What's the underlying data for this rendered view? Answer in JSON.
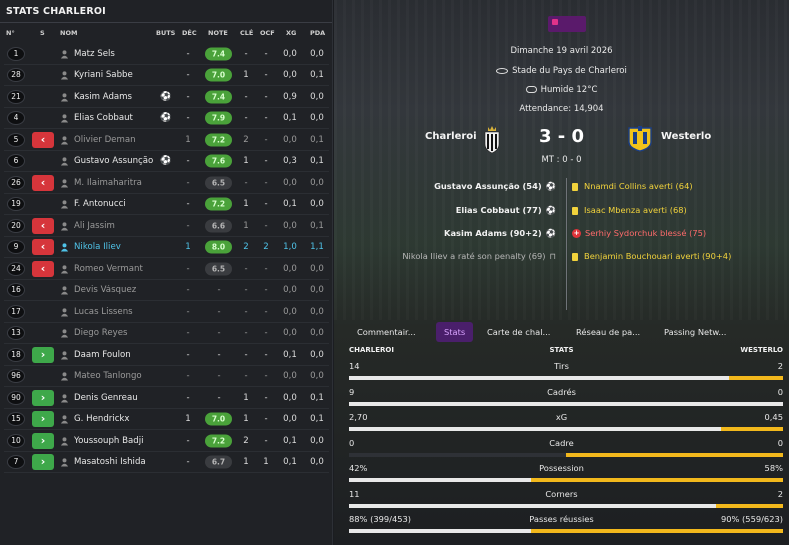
{
  "left_panel": {
    "title": "STATS CHARLEROI",
    "columns": {
      "num": "N°",
      "s": "S",
      "name": "NOM",
      "buts": "BUTS",
      "dec": "DÉC",
      "note": "NOTE",
      "cle": "CLÉ",
      "ocf": "OCF",
      "xg": "XG",
      "pda": "PDA"
    },
    "players": [
      {
        "num": "1",
        "sub": "",
        "name": "Matz Sels",
        "ball": "",
        "dec": "-",
        "rating": "7.4",
        "rating_style": "good",
        "cle": "-",
        "ocf": "-",
        "xg": "0,0",
        "pda": "0,0",
        "style": "normal",
        "buts": ""
      },
      {
        "num": "28",
        "sub": "",
        "name": "Kyriani Sabbe",
        "ball": "",
        "dec": "-",
        "rating": "7.0",
        "rating_style": "good",
        "cle": "1",
        "ocf": "-",
        "xg": "0,0",
        "pda": "0,1",
        "style": "normal",
        "buts": ""
      },
      {
        "num": "21",
        "sub": "",
        "name": "Kasim Adams",
        "ball": "⚽",
        "dec": "-",
        "rating": "7.4",
        "rating_style": "good",
        "cle": "-",
        "ocf": "-",
        "xg": "0,9",
        "pda": "0,0",
        "style": "normal",
        "buts": ""
      },
      {
        "num": "4",
        "sub": "",
        "name": "Elias Cobbaut",
        "ball": "⚽",
        "dec": "-",
        "rating": "7.9",
        "rating_style": "good",
        "cle": "-",
        "ocf": "-",
        "xg": "0,1",
        "pda": "0,0",
        "style": "normal",
        "buts": ""
      },
      {
        "num": "5",
        "sub": "out",
        "name": "Olivier Deman",
        "ball": "",
        "dec": "1",
        "rating": "7.2",
        "rating_style": "good",
        "cle": "2",
        "ocf": "-",
        "xg": "0,0",
        "pda": "0,1",
        "style": "dim",
        "buts": ""
      },
      {
        "num": "6",
        "sub": "",
        "name": "Gustavo Assunção",
        "ball": "⚽",
        "dec": "-",
        "rating": "7.6",
        "rating_style": "good",
        "cle": "1",
        "ocf": "-",
        "xg": "0,3",
        "pda": "0,1",
        "style": "normal",
        "buts": ""
      },
      {
        "num": "26",
        "sub": "out",
        "name": "M. Ilaimaharitra",
        "ball": "",
        "dec": "-",
        "rating": "6.5",
        "rating_style": "neutral",
        "cle": "-",
        "ocf": "-",
        "xg": "0,0",
        "pda": "0,0",
        "style": "dim",
        "buts": ""
      },
      {
        "num": "19",
        "sub": "",
        "name": "F. Antonucci",
        "ball": "",
        "dec": "-",
        "rating": "7.2",
        "rating_style": "good",
        "cle": "1",
        "ocf": "-",
        "xg": "0,1",
        "pda": "0,0",
        "style": "normal",
        "buts": ""
      },
      {
        "num": "20",
        "sub": "out",
        "name": "Ali Jassim",
        "ball": "",
        "dec": "-",
        "rating": "6.6",
        "rating_style": "neutral",
        "cle": "1",
        "ocf": "-",
        "xg": "0,0",
        "pda": "0,1",
        "style": "dim",
        "buts": ""
      },
      {
        "num": "9",
        "sub": "out",
        "name": "Nikola Iliev",
        "ball": "",
        "dec": "1",
        "rating": "8.0",
        "rating_style": "good",
        "cle": "2",
        "ocf": "2",
        "xg": "1,0",
        "pda": "1,1",
        "style": "hl",
        "buts": ""
      },
      {
        "num": "24",
        "sub": "out",
        "name": "Romeo Vermant",
        "ball": "",
        "dec": "-",
        "rating": "6.5",
        "rating_style": "neutral",
        "cle": "-",
        "ocf": "-",
        "xg": "0,0",
        "pda": "0,0",
        "style": "dim",
        "buts": ""
      },
      {
        "num": "16",
        "sub": "",
        "name": "Devis Vásquez",
        "ball": "",
        "dec": "-",
        "rating": "-",
        "rating_style": "none",
        "cle": "-",
        "ocf": "-",
        "xg": "0,0",
        "pda": "0,0",
        "style": "dim",
        "buts": ""
      },
      {
        "num": "17",
        "sub": "",
        "name": "Lucas Lissens",
        "ball": "",
        "dec": "-",
        "rating": "-",
        "rating_style": "none",
        "cle": "-",
        "ocf": "-",
        "xg": "0,0",
        "pda": "0,0",
        "style": "dim",
        "buts": ""
      },
      {
        "num": "13",
        "sub": "",
        "name": "Diego Reyes",
        "ball": "",
        "dec": "-",
        "rating": "-",
        "rating_style": "none",
        "cle": "-",
        "ocf": "-",
        "xg": "0,0",
        "pda": "0,0",
        "style": "dim",
        "buts": ""
      },
      {
        "num": "18",
        "sub": "in",
        "name": "Daam Foulon",
        "ball": "",
        "dec": "-",
        "rating": "-",
        "rating_style": "none",
        "cle": "-",
        "ocf": "-",
        "xg": "0,1",
        "pda": "0,0",
        "style": "normal",
        "buts": ""
      },
      {
        "num": "96",
        "sub": "",
        "name": "Mateo Tanlongo",
        "ball": "",
        "dec": "-",
        "rating": "-",
        "rating_style": "none",
        "cle": "-",
        "ocf": "-",
        "xg": "0,0",
        "pda": "0,0",
        "style": "dim",
        "buts": ""
      },
      {
        "num": "90",
        "sub": "in",
        "name": "Denis Genreau",
        "ball": "",
        "dec": "-",
        "rating": "-",
        "rating_style": "none",
        "cle": "1",
        "ocf": "-",
        "xg": "0,0",
        "pda": "0,1",
        "style": "normal",
        "buts": ""
      },
      {
        "num": "15",
        "sub": "in",
        "name": "G. Hendrickx",
        "ball": "",
        "dec": "1",
        "rating": "7.0",
        "rating_style": "good",
        "cle": "1",
        "ocf": "-",
        "xg": "0,0",
        "pda": "0,1",
        "style": "normal",
        "buts": ""
      },
      {
        "num": "10",
        "sub": "in",
        "name": "Youssouph Badji",
        "ball": "",
        "dec": "-",
        "rating": "7.2",
        "rating_style": "good",
        "cle": "2",
        "ocf": "-",
        "xg": "0,1",
        "pda": "0,0",
        "style": "normal",
        "buts": ""
      },
      {
        "num": "7",
        "sub": "in",
        "name": "Masatoshi Ishida",
        "ball": "",
        "dec": "-",
        "rating": "6.7",
        "rating_style": "neutral",
        "cle": "1",
        "ocf": "1",
        "xg": "0,1",
        "pda": "0,0",
        "style": "normal",
        "buts": ""
      }
    ]
  },
  "match": {
    "date": "Dimanche 19 avril 2026",
    "stadium": "Stade du Pays de Charleroi",
    "weather": "Humide 12°C",
    "attendance": "Attendance: 14,904",
    "home_team": "Charleroi",
    "away_team": "Westerlo",
    "score": "3 - 0",
    "half_time": "MT : 0 - 0",
    "home_events": [
      {
        "text": "Gustavo Assunção (54)",
        "icon": "⚽",
        "muted": false
      },
      {
        "text": "Elias Cobbaut (77)",
        "icon": "⚽",
        "muted": false
      },
      {
        "text": "Kasim Adams (90+2)",
        "icon": "⚽",
        "muted": false
      },
      {
        "text": "Nikola Iliev a raté son penalty (69)",
        "icon": "⊓",
        "muted": true
      }
    ],
    "away_events": [
      {
        "text": "Nnamdi Collins averti (64)",
        "type": "yellow"
      },
      {
        "text": "Isaac Mbenza averti (68)",
        "type": "yellow"
      },
      {
        "text": "Serhiy Sydorchuk blessé (75)",
        "type": "injury"
      },
      {
        "text": "Benjamin Bouchouari averti (90+4)",
        "type": "yellow"
      }
    ]
  },
  "tabs": [
    "Commentair...",
    "Stats",
    "Carte de chal...",
    "Réseau de pa...",
    "Passing Netw..."
  ],
  "active_tab": "Stats",
  "stats": {
    "home_label": "CHARLEROI",
    "center_label": "STATS",
    "away_label": "WESTERLO",
    "rows": [
      {
        "label": "Tirs",
        "home": "14",
        "away": "2",
        "home_share": 0.875,
        "away_share": 0.125
      },
      {
        "label": "Cadrés",
        "home": "9",
        "away": "0",
        "home_share": 1.0,
        "away_share": 0.0
      },
      {
        "label": "xG",
        "home": "2,70",
        "away": "0,45",
        "home_share": 0.857,
        "away_share": 0.143
      },
      {
        "label": "Cadre",
        "home": "0",
        "away": "0",
        "home_share": 0.0,
        "away_share": 0.5
      },
      {
        "label": "Possession",
        "home": "42%",
        "away": "58%",
        "home_share": 0.42,
        "away_share": 0.58
      },
      {
        "label": "Corners",
        "home": "11",
        "away": "2",
        "home_share": 0.846,
        "away_share": 0.154
      },
      {
        "label": "Passes réussies",
        "home": "88% (399/453)",
        "away": "90% (559/623)",
        "home_share": 0.42,
        "away_share": 0.58
      }
    ]
  },
  "colors": {
    "accent_green": "#4aa23a",
    "accent_yellow": "#f2b81c",
    "sub_out": "#d6353b",
    "sub_in": "#3ea84a",
    "highlight": "#4fc3e8",
    "tab_active_bg": "#4a1f6b"
  }
}
